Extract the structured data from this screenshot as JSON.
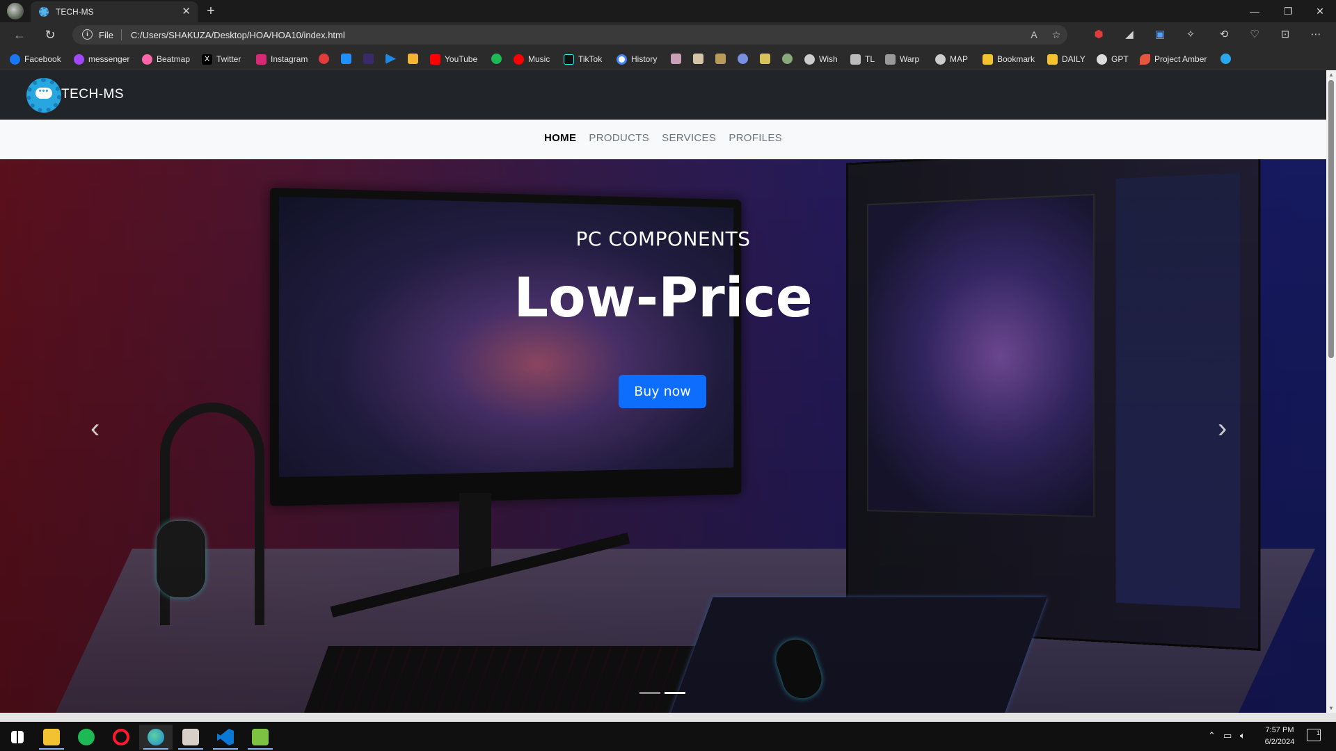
{
  "browser": {
    "tab_title": "TECH-MS",
    "tab_close": "✕",
    "new_tab": "+",
    "url_scheme_label": "File",
    "url": "C:/Users/SHAKUZA/Desktop/HOA/HOA10/index.html",
    "window_controls": {
      "minimize": "—",
      "restore": "❐",
      "close": "✕"
    }
  },
  "bookmarks": [
    {
      "label": "Facebook",
      "color": "#1877f2"
    },
    {
      "label": "messenger",
      "color": "#a347ff"
    },
    {
      "label": "Beatmap",
      "color": "#ff66aa"
    },
    {
      "label": "Twitter",
      "color": "#000000"
    },
    {
      "label": "Instagram",
      "color": "#d62976"
    },
    {
      "label": "YouTube",
      "color": "#ff0000"
    },
    {
      "label": "Music",
      "color": "#ff0000"
    },
    {
      "label": "TikTok",
      "color": "#000000"
    },
    {
      "label": "History",
      "color": "#4285f4"
    },
    {
      "label": "Wish",
      "color": "#cccccc"
    },
    {
      "label": "TL",
      "color": "#bbbbbb"
    },
    {
      "label": "Warp",
      "color": "#999999"
    },
    {
      "label": "MAP",
      "color": "#cccccc"
    },
    {
      "label": "Bookmark",
      "color": "#f2c230"
    },
    {
      "label": "DAILY",
      "color": "#f2c230"
    },
    {
      "label": "GPT",
      "color": "#dddddd"
    },
    {
      "label": "Project Amber",
      "color": "#e8553d"
    }
  ],
  "site": {
    "brand": "TECH-MS",
    "nav": [
      {
        "label": "HOME",
        "active": true
      },
      {
        "label": "PRODUCTS",
        "active": false
      },
      {
        "label": "SERVICES",
        "active": false
      },
      {
        "label": "PROFILES",
        "active": false
      }
    ],
    "hero": {
      "subtitle": "PC COMPONENTS",
      "title": "Low-Price",
      "button": "Buy now",
      "prev": "‹",
      "next": "›",
      "active_slide": 2,
      "slide_count": 2
    }
  },
  "taskbar": {
    "time": "7:57 PM",
    "date": "6/2/2024",
    "notifications": "1"
  }
}
